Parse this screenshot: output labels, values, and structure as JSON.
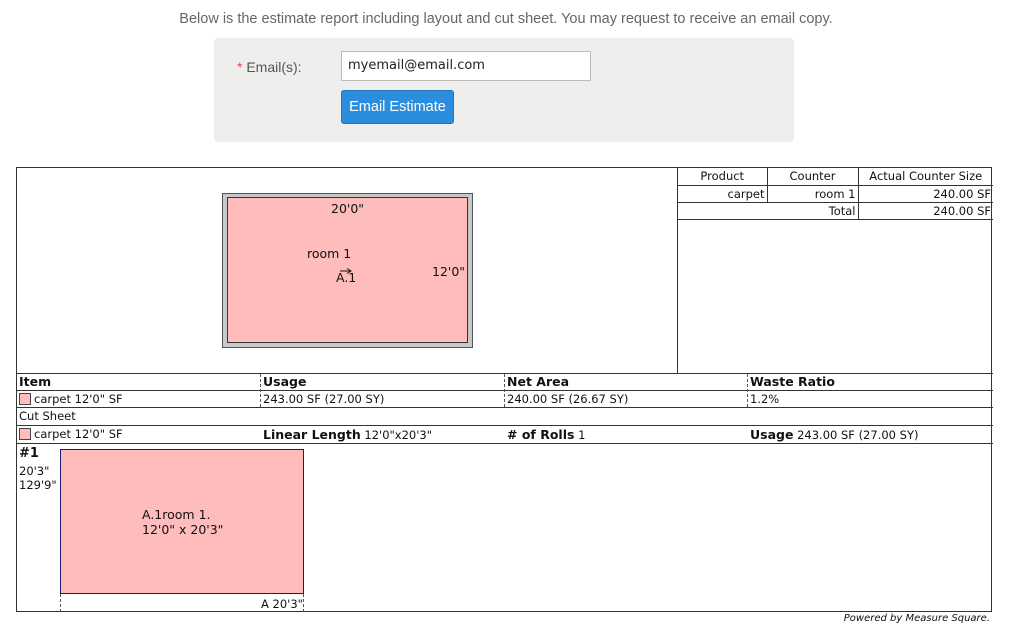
{
  "intro_text": "Below is the estimate report including layout and cut sheet. You may request to receive an email copy.",
  "email": {
    "required_mark": "*",
    "label": "Email(s):",
    "value": "myemail@email.com",
    "button_label": "Email Estimate"
  },
  "layout": {
    "room_name": "room 1",
    "width_dim": "20'0\"",
    "height_dim": "12'0\"",
    "area_label": "A.1"
  },
  "summary_table": {
    "headers": [
      "Product",
      "Counter",
      "Actual Counter Size"
    ],
    "rows": [
      [
        "carpet",
        "room 1",
        "240.00 SF"
      ]
    ],
    "total_label": "Total",
    "total_value": "240.00 SF"
  },
  "items_table": {
    "headers": [
      "Item",
      "Usage",
      "Net Area",
      "Waste Ratio"
    ],
    "row": [
      "carpet 12'0\" SF",
      "243.00 SF (27.00 SY)",
      "240.00 SF (26.67 SY)",
      "1.2%"
    ]
  },
  "cut_sheet": {
    "title": "Cut Sheet",
    "item": "carpet 12'0\" SF",
    "linear_length_label": "Linear Length",
    "linear_length_value": "12'0\"x20'3\"",
    "rolls_label": "# of Rolls",
    "rolls_value": "1",
    "usage_label": "Usage",
    "usage_value": "243.00 SF (27.00 SY)",
    "roll_number": "#1",
    "roll_length_1": "20'3\"",
    "roll_length_2": "129'9\"",
    "cut_label_line1": "A.1room 1.",
    "cut_label_line2": "12'0\" x 20'3\"",
    "bottom_dim": "A 20'3\""
  },
  "footer": "Powered by Measure Square."
}
